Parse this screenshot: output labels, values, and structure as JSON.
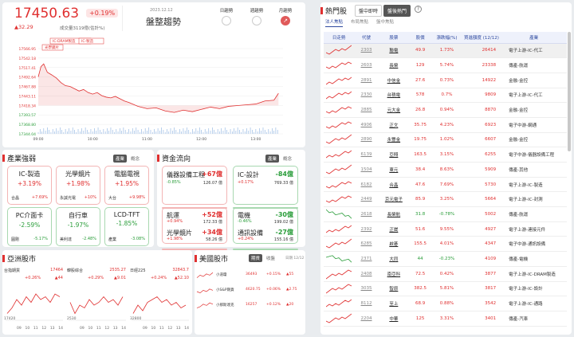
{
  "index": {
    "value": "17450.63",
    "pct": "+0.19%",
    "change": "▲32.29",
    "volume": "成交量3119億(估計%)",
    "date": "2023.12.12",
    "trend_title": "盤整趨勢",
    "trend_buttons": [
      "日趨勢",
      "週趨勢",
      "月趨勢"
    ],
    "callouts": [
      "IC-DRAM製造",
      "光學鏡片",
      "IC-製造"
    ]
  },
  "chart_data": {
    "type": "line",
    "x_ticks": [
      "09:00",
      "10:00",
      "11:00",
      "12:00",
      "13:00"
    ],
    "y_ticks": [
      17566.95,
      17542.18,
      17517.41,
      17492.64,
      17467.88,
      17443.11,
      17418.34,
      17393.57,
      17368.8,
      17344.04
    ],
    "ylim": [
      17344.04,
      17566.95
    ],
    "reference": 17418.34,
    "series": [
      {
        "x": [
          0,
          3,
          6,
          10,
          15,
          20,
          25,
          30,
          35,
          40,
          45,
          50,
          55,
          60,
          65,
          70,
          75,
          80,
          85,
          90,
          95,
          100,
          110,
          120,
          130,
          140,
          150,
          160,
          170,
          180,
          190,
          200,
          210,
          220,
          230,
          240,
          250,
          260,
          265
        ],
        "y": [
          17493,
          17520,
          17527,
          17505,
          17498,
          17490,
          17478,
          17470,
          17468,
          17462,
          17456,
          17460,
          17452,
          17448,
          17452,
          17444,
          17440,
          17438,
          17442,
          17436,
          17430,
          17426,
          17416,
          17410,
          17412,
          17404,
          17400,
          17406,
          17402,
          17408,
          17414,
          17410,
          17416,
          17418,
          17420,
          17422,
          17430,
          17432,
          17450
        ]
      }
    ]
  },
  "industry": {
    "title": "產業強弱",
    "tabs": [
      "產業",
      "概念"
    ],
    "cards": [
      {
        "name": "IC-製造",
        "pct": "+3.19%",
        "leader": "合晶",
        "lpct": "+7.69%",
        "dir": "up"
      },
      {
        "name": "光學鏡片",
        "pct": "+1.98%",
        "leader": "永誠光電",
        "lpct": "+10%",
        "dir": "up"
      },
      {
        "name": "電腦電視",
        "pct": "+1.95%",
        "leader": "大台",
        "lpct": "+9.98%",
        "dir": "up"
      },
      {
        "name": "PC介面卡",
        "pct": "-2.59%",
        "leader": "圓剛",
        "lpct": "-5.17%",
        "dir": "dn"
      },
      {
        "name": "自行車",
        "pct": "-1.97%",
        "leader": "美利達",
        "lpct": "-2.48%",
        "dir": "dn"
      },
      {
        "name": "LCD-TFT",
        "pct": "-1.85%",
        "leader": "產業",
        "lpct": "-3.08%",
        "dir": "dn"
      }
    ]
  },
  "flow": {
    "title": "資金流向",
    "tabs": [
      "產業",
      "概念"
    ],
    "cards": [
      {
        "name": "儀器設備工程",
        "val": "+67億",
        "pct": "-0.85%",
        "info": "126.07 億",
        "dir": "up"
      },
      {
        "name": "IC-設計",
        "val": "-84億",
        "pct": "+0.17%",
        "info": "769.33 億",
        "dir": "dn"
      },
      {
        "name": "航運",
        "val": "+52億",
        "pct": "+0.94%",
        "info": "172.33 億",
        "dir": "up"
      },
      {
        "name": "電機",
        "val": "-30億",
        "pct": "-0.46%",
        "info": "199.02 億",
        "dir": "dn"
      },
      {
        "name": "光學鏡片",
        "val": "+34億",
        "pct": "+1.98%",
        "info": "58.26 億",
        "dir": "up"
      },
      {
        "name": "通訊設備",
        "val": "-27億",
        "pct": "+0.24%",
        "info": "155.16 億",
        "dir": "dn"
      }
    ]
  },
  "asia": {
    "title": "亞洲股市",
    "markets": [
      {
        "name": "台指期貨",
        "value": "17464",
        "pct": "+0.26%",
        "chg": "▲44",
        "lo": "17420",
        "ticks": [
          "09",
          "10",
          "11",
          "12",
          "13",
          "14"
        ]
      },
      {
        "name": "韓股綜合",
        "value": "2535.27",
        "pct": "+0.29%",
        "chg": "▲9.01",
        "lo": "2530",
        "ticks": [
          "09",
          "10",
          "11",
          "12",
          "13",
          "14"
        ]
      },
      {
        "name": "日經225",
        "value": "32843.7",
        "pct": "+0.24%",
        "chg": "▲52.10",
        "lo": "32800",
        "ticks": [
          "09",
          "10",
          "11",
          "12",
          "13",
          "14"
        ]
      }
    ]
  },
  "us": {
    "title": "美國股市",
    "tabs": [
      "期貨",
      "收盤"
    ],
    "date": "日期 12/12",
    "rows": [
      {
        "name": "小道瓊",
        "value": "36493",
        "pct": "+0.15%",
        "chg": "▲55"
      },
      {
        "name": "小S&P期貨",
        "value": "4620.75",
        "pct": "+0.06%",
        "chg": "▲2.75"
      },
      {
        "name": "小那斯達克",
        "value": "16257",
        "pct": "+0.12%",
        "chg": "▲20"
      }
    ]
  },
  "hot": {
    "title": "熱門股",
    "modes": [
      "盤中即時",
      "盤後熱門"
    ],
    "tabs": [
      "法人焦點",
      "布局焦點",
      "盤中焦點"
    ],
    "headers": [
      "日走勢",
      "代號",
      "股票",
      "股價",
      "漲跌幅(%)",
      "買進額度 (12/12)",
      "產業"
    ],
    "rows": [
      {
        "code": "2303",
        "name": "聯電",
        "price": "49.9",
        "pct": "1.73%",
        "amt": "26414",
        "ind": "電子上游-IC-代工",
        "dir": "up"
      },
      {
        "code": "2603",
        "name": "長榮",
        "price": "129",
        "pct": "5.74%",
        "amt": "23338",
        "ind": "傳產-航運",
        "dir": "up"
      },
      {
        "code": "2891",
        "name": "中信金",
        "price": "27.6",
        "pct": "0.73%",
        "amt": "14922",
        "ind": "金融-金控",
        "dir": "up"
      },
      {
        "code": "2330",
        "name": "台積電",
        "price": "578",
        "pct": "0.7%",
        "amt": "9809",
        "ind": "電子上游-IC-代工",
        "dir": "up"
      },
      {
        "code": "2885",
        "name": "元大金",
        "price": "26.8",
        "pct": "0.94%",
        "amt": "8870",
        "ind": "金融-金控",
        "dir": "up"
      },
      {
        "code": "4906",
        "name": "正文",
        "price": "35.75",
        "pct": "4.23%",
        "amt": "6923",
        "ind": "電子中游-網通",
        "dir": "up"
      },
      {
        "code": "2890",
        "name": "永豐金",
        "price": "19.75",
        "pct": "1.02%",
        "amt": "6607",
        "ind": "金融-金控",
        "dir": "up"
      },
      {
        "code": "6139",
        "name": "亞翔",
        "price": "163.5",
        "pct": "3.15%",
        "amt": "6255",
        "ind": "電子中游-儀器設備工程",
        "dir": "up"
      },
      {
        "code": "1504",
        "name": "東元",
        "price": "38.4",
        "pct": "8.63%",
        "amt": "5909",
        "ind": "傳產-其他",
        "dir": "up"
      },
      {
        "code": "6182",
        "name": "合晶",
        "price": "47.6",
        "pct": "7.69%",
        "amt": "5730",
        "ind": "電子上游-IC-製造",
        "dir": "up"
      },
      {
        "code": "2449",
        "name": "京元電子",
        "price": "85.9",
        "pct": "3.25%",
        "amt": "5664",
        "ind": "電子上游-IC-封測",
        "dir": "up"
      },
      {
        "code": "2618",
        "name": "長榮航",
        "price": "31.8",
        "pct": "-0.78%",
        "amt": "5002",
        "ind": "傳產-航運",
        "dir": "dn"
      },
      {
        "code": "2392",
        "name": "正崴",
        "price": "51.6",
        "pct": "9.55%",
        "amt": "4927",
        "ind": "電子上游-連接元件",
        "dir": "up"
      },
      {
        "code": "6285",
        "name": "啟碁",
        "price": "155.5",
        "pct": "4.01%",
        "amt": "4347",
        "ind": "電子中游-通訊設備",
        "dir": "up"
      },
      {
        "code": "2371",
        "name": "大同",
        "price": "44",
        "pct": "-0.23%",
        "amt": "4109",
        "ind": "傳產-電機",
        "dir": "dn"
      },
      {
        "code": "2408",
        "name": "南亞科",
        "price": "72.5",
        "pct": "0.42%",
        "amt": "3877",
        "ind": "電子上游-IC-DRAM製造",
        "dir": "up"
      },
      {
        "code": "3035",
        "name": "智原",
        "price": "382.5",
        "pct": "5.81%",
        "amt": "3817",
        "ind": "電子上游-IC-設計",
        "dir": "up"
      },
      {
        "code": "8112",
        "name": "至上",
        "price": "68.9",
        "pct": "0.88%",
        "amt": "3542",
        "ind": "電子上游-IC-通路",
        "dir": "up"
      },
      {
        "code": "2204",
        "name": "中華",
        "price": "125",
        "pct": "3.31%",
        "amt": "3401",
        "ind": "傳產-汽車",
        "dir": "up"
      }
    ]
  }
}
